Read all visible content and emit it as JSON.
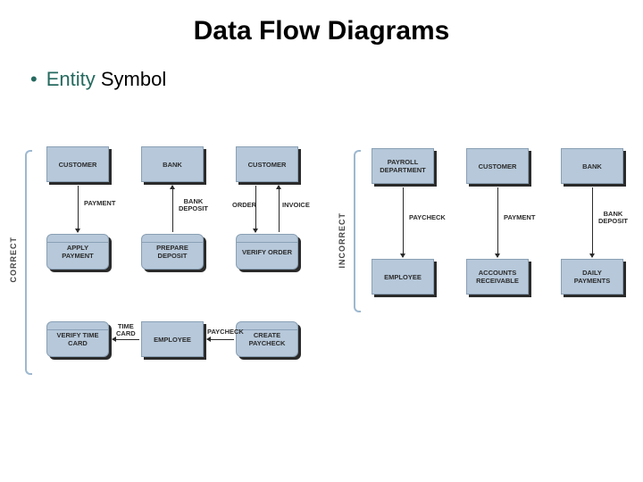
{
  "title": "Data Flow Diagrams",
  "bullet": {
    "accent": "Entity",
    "plain": " Symbol"
  },
  "correct": {
    "label": "CORRECT",
    "customer": "CUSTOMER",
    "bank": "BANK",
    "customer2": "CUSTOMER",
    "applyPayment": "APPLY\nPAYMENT",
    "prepareDeposit": "PREPARE\nDEPOSIT",
    "verifyOrder": "VERIFY\nORDER",
    "verifyTimeCard": "VERIFY\nTIME\nCARD",
    "employee": "EMPLOYEE",
    "createPaycheck": "CREATE\nPAYCHECK",
    "flows": {
      "payment": "PAYMENT",
      "bankDeposit": "BANK\nDEPOSIT",
      "order": "ORDER",
      "invoice": "INVOICE",
      "timeCard": "TIME\nCARD",
      "paycheck": "PAYCHECK"
    }
  },
  "incorrect": {
    "label": "INCORRECT",
    "payrollDept": "PAYROLL\nDEPARTMENT",
    "customer": "CUSTOMER",
    "bank": "BANK",
    "employee": "EMPLOYEE",
    "accountsReceivable": "ACCOUNTS\nRECEIVABLE",
    "dailyPayments": "DAILY\nPAYMENTS",
    "flows": {
      "paycheck": "PAYCHECK",
      "payment": "PAYMENT",
      "bankDeposit": "BANK\nDEPOSIT"
    }
  }
}
